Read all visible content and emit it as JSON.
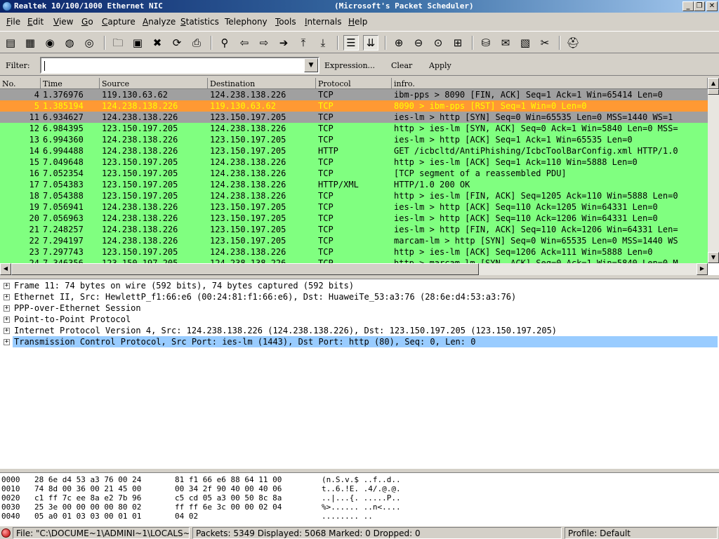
{
  "window": {
    "title_left": "Realtek 10/100/1000 Ethernet NIC",
    "title_mid": "(Microsoft's Packet Scheduler)",
    "minimize": "_",
    "maximize": "❐",
    "close": "✕"
  },
  "menu": [
    {
      "u": "F",
      "rest": "ile"
    },
    {
      "u": "E",
      "rest": "dit"
    },
    {
      "u": "V",
      "rest": "iew"
    },
    {
      "u": "G",
      "rest": "o"
    },
    {
      "u": "C",
      "rest": "apture"
    },
    {
      "u": "A",
      "rest": "nalyze"
    },
    {
      "u": "S",
      "rest": "tatistics"
    },
    {
      "u": "",
      "rest": "Telephony"
    },
    {
      "u": "T",
      "rest": "ools"
    },
    {
      "u": "I",
      "rest": "nternals"
    },
    {
      "u": "H",
      "rest": "elp"
    }
  ],
  "toolbar": [
    {
      "icon": "interface-list-icon",
      "glyph": "▤"
    },
    {
      "icon": "capture-options-icon",
      "glyph": "▦"
    },
    {
      "icon": "start-capture-icon",
      "glyph": "◉"
    },
    {
      "icon": "stop-capture-icon",
      "glyph": "◍"
    },
    {
      "icon": "restart-capture-icon",
      "glyph": "◎"
    },
    {
      "icon": "open-file-icon",
      "glyph": "🗀"
    },
    {
      "icon": "save-file-icon",
      "glyph": "▣"
    },
    {
      "icon": "close-file-icon",
      "glyph": "✖"
    },
    {
      "icon": "reload-icon",
      "glyph": "⟳"
    },
    {
      "icon": "print-icon",
      "glyph": "⎙"
    },
    {
      "icon": "find-packet-icon",
      "glyph": "⚲"
    },
    {
      "icon": "go-back-icon",
      "glyph": "⇦"
    },
    {
      "icon": "go-forward-icon",
      "glyph": "⇨"
    },
    {
      "icon": "go-to-packet-icon",
      "glyph": "➔"
    },
    {
      "icon": "go-first-icon",
      "glyph": "⤒"
    },
    {
      "icon": "go-last-icon",
      "glyph": "⤓"
    },
    {
      "icon": "colorize-icon",
      "glyph": "☰"
    },
    {
      "icon": "auto-scroll-icon",
      "glyph": "⇊"
    },
    {
      "icon": "zoom-in-icon",
      "glyph": "⊕"
    },
    {
      "icon": "zoom-out-icon",
      "glyph": "⊖"
    },
    {
      "icon": "normal-size-icon",
      "glyph": "⊙"
    },
    {
      "icon": "resize-columns-icon",
      "glyph": "⊞"
    },
    {
      "icon": "capture-filters-icon",
      "glyph": "⛁"
    },
    {
      "icon": "display-filters-icon",
      "glyph": "✉"
    },
    {
      "icon": "coloring-rules-icon",
      "glyph": "▧"
    },
    {
      "icon": "preferences-icon",
      "glyph": "✂"
    },
    {
      "icon": "help-icon",
      "glyph": "⛑"
    }
  ],
  "filter": {
    "label": "Filter:",
    "value": "",
    "expression": "Expression...",
    "clear": "Clear",
    "apply": "Apply"
  },
  "columns": [
    "No.",
    "Time",
    "Source",
    "Destination",
    "Protocol",
    "infro."
  ],
  "colors": {
    "tcp_grey": "#a0a0a0",
    "tcp_green": "#80ff80",
    "rst_orange": "#ff9933",
    "rst_text": "#ffff00",
    "selected_detail": "#99ccff"
  },
  "packets": [
    {
      "no": "4",
      "time": "1.376976",
      "src": "119.130.63.62",
      "dst": "124.238.138.226",
      "proto": "TCP",
      "info": "ibm-pps > 8090 [FIN, ACK] Seq=1 Ack=1 Win=65414 Len=0",
      "bg": "#a0a0a0",
      "fg": "#000000"
    },
    {
      "no": "5",
      "time": "1.385194",
      "src": "124.238.138.226",
      "dst": "119.130.63.62",
      "proto": "TCP",
      "info": "8090 > ibm-pps [RST] Seq=1 Win=0 Len=0",
      "bg": "#ff9933",
      "fg": "#ffff00"
    },
    {
      "no": "11",
      "time": "6.934627",
      "src": "124.238.138.226",
      "dst": "123.150.197.205",
      "proto": "TCP",
      "info": "ies-lm > http [SYN] Seq=0 Win=65535 Len=0 MSS=1440 WS=1",
      "bg": "#a0a0a0",
      "fg": "#000000"
    },
    {
      "no": "12",
      "time": "6.984395",
      "src": "123.150.197.205",
      "dst": "124.238.138.226",
      "proto": "TCP",
      "info": "http > ies-lm [SYN, ACK] Seq=0 Ack=1 Win=5840 Len=0 MSS=",
      "bg": "#80ff80",
      "fg": "#000000"
    },
    {
      "no": "13",
      "time": "6.994360",
      "src": "124.238.138.226",
      "dst": "123.150.197.205",
      "proto": "TCP",
      "info": "ies-lm > http [ACK] Seq=1 Ack=1 Win=65535 Len=0",
      "bg": "#80ff80",
      "fg": "#000000"
    },
    {
      "no": "14",
      "time": "6.994488",
      "src": "124.238.138.226",
      "dst": "123.150.197.205",
      "proto": "HTTP",
      "info": "GET /icbcltd/AntiPhishing/IcbcToolBarConfig.xml HTTP/1.0",
      "bg": "#80ff80",
      "fg": "#000000"
    },
    {
      "no": "15",
      "time": "7.049648",
      "src": "123.150.197.205",
      "dst": "124.238.138.226",
      "proto": "TCP",
      "info": "http > ies-lm [ACK] Seq=1 Ack=110 Win=5888 Len=0",
      "bg": "#80ff80",
      "fg": "#000000"
    },
    {
      "no": "16",
      "time": "7.052354",
      "src": "123.150.197.205",
      "dst": "124.238.138.226",
      "proto": "TCP",
      "info": "[TCP segment of a reassembled PDU]",
      "bg": "#80ff80",
      "fg": "#000000"
    },
    {
      "no": "17",
      "time": "7.054383",
      "src": "123.150.197.205",
      "dst": "124.238.138.226",
      "proto": "HTTP/XML",
      "info": "HTTP/1.0 200 OK",
      "bg": "#80ff80",
      "fg": "#000000"
    },
    {
      "no": "18",
      "time": "7.054388",
      "src": "123.150.197.205",
      "dst": "124.238.138.226",
      "proto": "TCP",
      "info": "http > ies-lm [FIN, ACK] Seq=1205 Ack=110 Win=5888 Len=0",
      "bg": "#80ff80",
      "fg": "#000000"
    },
    {
      "no": "19",
      "time": "7.056941",
      "src": "124.238.138.226",
      "dst": "123.150.197.205",
      "proto": "TCP",
      "info": "ies-lm > http [ACK] Seq=110 Ack=1205 Win=64331 Len=0",
      "bg": "#80ff80",
      "fg": "#000000"
    },
    {
      "no": "20",
      "time": "7.056963",
      "src": "124.238.138.226",
      "dst": "123.150.197.205",
      "proto": "TCP",
      "info": "ies-lm > http [ACK] Seq=110 Ack=1206 Win=64331 Len=0",
      "bg": "#80ff80",
      "fg": "#000000"
    },
    {
      "no": "21",
      "time": "7.248257",
      "src": "124.238.138.226",
      "dst": "123.150.197.205",
      "proto": "TCP",
      "info": "ies-lm > http [FIN, ACK] Seq=110 Ack=1206 Win=64331 Len=",
      "bg": "#80ff80",
      "fg": "#000000"
    },
    {
      "no": "22",
      "time": "7.294197",
      "src": "124.238.138.226",
      "dst": "123.150.197.205",
      "proto": "TCP",
      "info": "marcam-lm > http [SYN] Seq=0 Win=65535 Len=0 MSS=1440 WS",
      "bg": "#80ff80",
      "fg": "#000000"
    },
    {
      "no": "23",
      "time": "7.297743",
      "src": "123.150.197.205",
      "dst": "124.238.138.226",
      "proto": "TCP",
      "info": "http > ies-lm [ACK] Seq=1206 Ack=111 Win=5888 Len=0",
      "bg": "#80ff80",
      "fg": "#000000"
    },
    {
      "no": "24",
      "time": "7.346356",
      "src": "123.150.197.205",
      "dst": "124.238.138.226",
      "proto": "TCP",
      "info": "http > marcam-lm [SYN, ACK] Seq=0 Ack=1 Win=5840 Len=0 M",
      "bg": "#80ff80",
      "fg": "#000000"
    }
  ],
  "details": [
    {
      "text": "Frame 11: 74 bytes on wire (592 bits), 74 bytes captured (592 bits)",
      "selected": false
    },
    {
      "text": "Ethernet II, Src: HewlettP_f1:66:e6 (00:24:81:f1:66:e6), Dst: HuaweiTe_53:a3:76 (28:6e:d4:53:a3:76)",
      "selected": false
    },
    {
      "text": "PPP-over-Ethernet Session",
      "selected": false
    },
    {
      "text": "Point-to-Point Protocol",
      "selected": false
    },
    {
      "text": "Internet Protocol Version 4, Src: 124.238.138.226 (124.238.138.226), Dst: 123.150.197.205 (123.150.197.205)",
      "selected": false
    },
    {
      "text": "Transmission Control Protocol, Src Port: ies-lm (1443), Dst Port: http (80), Seq: 0, Len: 0",
      "selected": true
    }
  ],
  "bytes": [
    {
      "off": "0000",
      "hex1": "28 6e d4 53 a3 76 00 24",
      "hex2": "81 f1 66 e6 88 64 11 00",
      "ascii": "(n.S.v.$ ..f..d.."
    },
    {
      "off": "0010",
      "hex1": "74 8d 00 36 00 21 45 00",
      "hex2": "00 34 2f 90 40 00 40 06",
      "ascii": "t..6.!E. .4/.@.@."
    },
    {
      "off": "0020",
      "hex1": "c1 ff 7c ee 8a e2 7b 96",
      "hex2": "c5 cd 05 a3 00 50 8c 8a",
      "ascii": "..|...{. .....P.."
    },
    {
      "off": "0030",
      "hex1": "25 3e 00 00 00 00 80 02",
      "hex2": "ff ff 6e 3c 00 00 02 04",
      "ascii": "%>...... ..n<...."
    },
    {
      "off": "0040",
      "hex1": "05 a0 01 03 03 00 01 01",
      "hex2": "04 02",
      "ascii": "........ .."
    }
  ],
  "status": {
    "file": "File: \"C:\\DOCUME~1\\ADMINI~1\\LOCALS~...",
    "packets": "Packets: 5349 Displayed: 5068 Marked: 0 Dropped: 0",
    "profile": "Profile: Default"
  }
}
